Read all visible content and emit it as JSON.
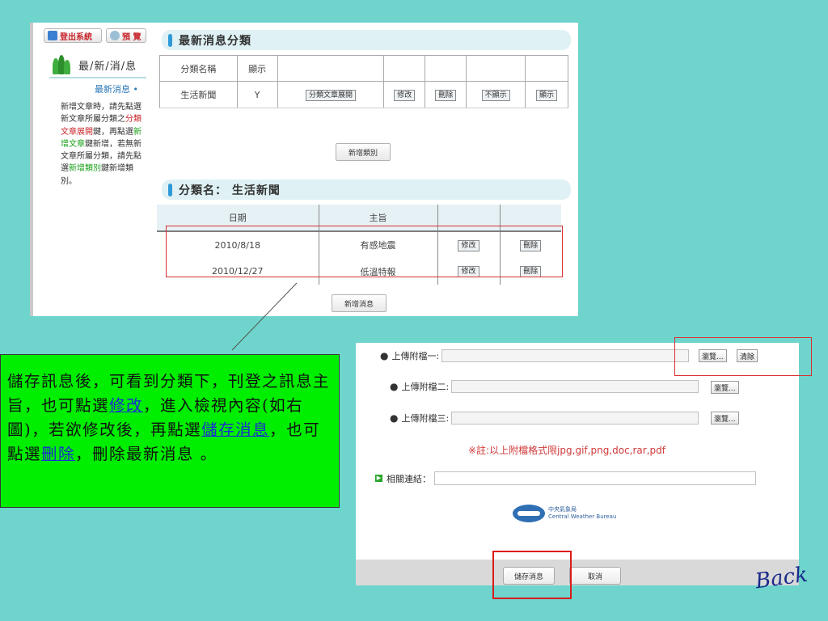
{
  "top_panel": {
    "logout_label": "登出系統",
    "preview_label": "預 覽",
    "sidebar_title": "最/新/消/息",
    "sidebar_section": "最新消息 •",
    "help": {
      "t1": "新增文章時，請先點選新文章所屬分類之",
      "t2": "分類文章展開",
      "t3": "鍵，再點選",
      "t4": "新增文章",
      "t5": "鍵新增，若無新文章所屬分類，請先點選",
      "t6": "新增類別",
      "t7": "鍵新增類別。"
    },
    "category_section_title": "最新消息分類",
    "category_table": {
      "headers": [
        "分類名稱",
        "顯示",
        "",
        "",
        "",
        "",
        ""
      ],
      "rows": [
        {
          "name": "生活新聞",
          "visible": "Y",
          "expand_label": "分類文章展開",
          "edit_label": "修改",
          "delete_label": "刪除",
          "hide_label": "不顯示",
          "show_label": "顯示"
        }
      ]
    },
    "add_category_label": "新增類別",
    "news_section_title": "分類名： 生活新聞",
    "news_table": {
      "headers": [
        "日期",
        "主旨",
        "",
        ""
      ],
      "rows": [
        {
          "date": "2010/8/18",
          "subject": "有感地震",
          "edit_label": "修改",
          "delete_label": "刪除"
        },
        {
          "date": "2010/12/27",
          "subject": "低溫特報",
          "edit_label": "修改",
          "delete_label": "刪除"
        }
      ]
    },
    "add_news_label": "新增消息"
  },
  "note": {
    "p1": "儲存訊息後，可看到分類下，刊登之訊息主旨，也可點選",
    "link_edit": "修改",
    "p2": "，進入檢視內容(如右圖)，若欲修改後，再點選",
    "link_save": "儲存消息",
    "p3": "，也可點選",
    "link_delete": "刪除",
    "p4": "，刪除最新消息 。"
  },
  "form": {
    "upload1_label": "上傳附檔一:",
    "upload2_label": "上傳附檔二:",
    "upload3_label": "上傳附檔三:",
    "browse_label": "瀏覽...",
    "clear_label": "清除",
    "upload_note": "※註:以上附檔格式限jpg,gif,png,doc,rar,pdf",
    "related_link_label": "相關連結：",
    "logo_name_zh": "中央氣象局",
    "logo_name_en": "Central Weather Bureau",
    "save_label": "儲存消息",
    "cancel_label": "取消"
  },
  "back_label": "Back"
}
